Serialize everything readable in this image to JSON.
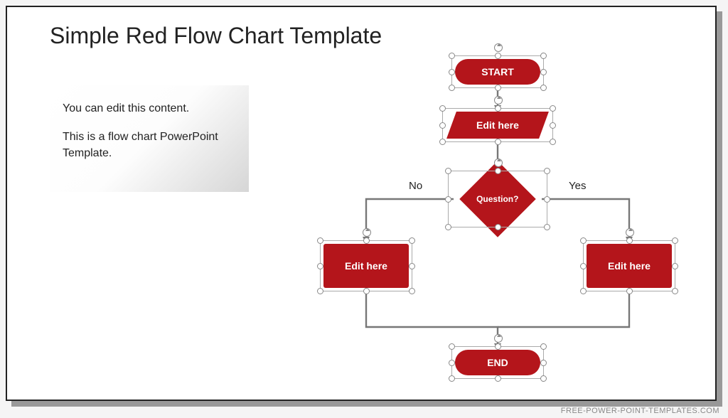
{
  "title": "Simple Red Flow Chart Template",
  "textbox": {
    "line1": "You can edit this content.",
    "line2": "This is a flow chart PowerPoint Template."
  },
  "flow": {
    "start": "START",
    "process1": "Edit here",
    "decision": "Question?",
    "branch_no": "No",
    "branch_yes": "Yes",
    "process_no": "Edit here",
    "process_yes": "Edit here",
    "end": "END"
  },
  "colors": {
    "shape_fill": "#b4151b",
    "connector": "#777"
  },
  "watermark": "FREE-POWER-POINT-TEMPLATES.COM"
}
